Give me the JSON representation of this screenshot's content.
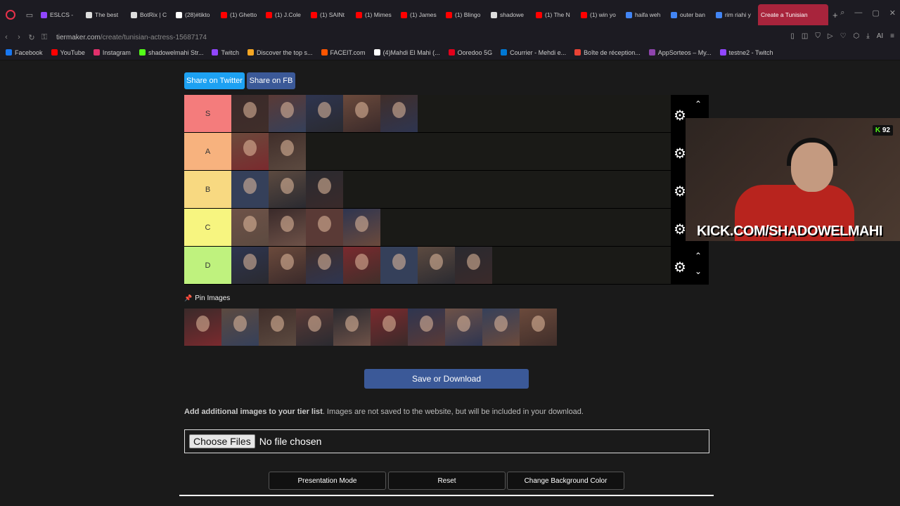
{
  "browser": {
    "tabs": [
      {
        "label": "ESLCS -",
        "color": "#9146ff"
      },
      {
        "label": "The best",
        "color": "#dddddd"
      },
      {
        "label": "BotRix | C",
        "color": "#dddddd"
      },
      {
        "label": "(28)#tikto",
        "color": "#ffffff"
      },
      {
        "label": "(1) Ghetto",
        "color": "#ff0000"
      },
      {
        "label": "(1) J.Cole",
        "color": "#ff0000"
      },
      {
        "label": "(1) SAINt",
        "color": "#ff0000"
      },
      {
        "label": "(1) Mimes",
        "color": "#ff0000"
      },
      {
        "label": "(1) James",
        "color": "#ff0000"
      },
      {
        "label": "(1) Blingo",
        "color": "#ff0000"
      },
      {
        "label": "shadowe",
        "color": "#dddddd"
      },
      {
        "label": "(1) The N",
        "color": "#ff0000"
      },
      {
        "label": "(1) win yo",
        "color": "#ff0000"
      },
      {
        "label": "haifa weh",
        "color": "#4285f4"
      },
      {
        "label": "outer ban",
        "color": "#4285f4"
      },
      {
        "label": "rim riahi y",
        "color": "#4285f4"
      }
    ],
    "active_tab": "Create a Tunisian",
    "url_host": "tiermaker.com",
    "url_path": "/create/tunisian-actress-15687174",
    "bookmarks": [
      {
        "label": "Facebook",
        "color": "#1877f2"
      },
      {
        "label": "YouTube",
        "color": "#ff0000"
      },
      {
        "label": "Instagram",
        "color": "#e1306c"
      },
      {
        "label": "shadowelmahi Str...",
        "color": "#53fc18"
      },
      {
        "label": "Twitch",
        "color": "#9146ff"
      },
      {
        "label": "Discover the top s...",
        "color": "#f5a623"
      },
      {
        "label": "FACEIT.com",
        "color": "#ff5500"
      },
      {
        "label": "(4)Mahdi El Mahi (...",
        "color": "#ffffff"
      },
      {
        "label": "Ooredoo 5G",
        "color": "#e3001b"
      },
      {
        "label": "Courrier - Mehdi e...",
        "color": "#0078d4"
      },
      {
        "label": "Boîte de réception...",
        "color": "#ea4335"
      },
      {
        "label": "AppSorteos – My...",
        "color": "#8e44ad"
      },
      {
        "label": "testne2 - Twitch",
        "color": "#9146ff"
      }
    ]
  },
  "share": {
    "twitter": "Share on Twitter",
    "facebook": "Share on FB"
  },
  "tiers": [
    {
      "label": "S",
      "color": "#f47c7c",
      "count": 5
    },
    {
      "label": "A",
      "color": "#f7b27e",
      "count": 2
    },
    {
      "label": "B",
      "color": "#f8d981",
      "count": 3
    },
    {
      "label": "C",
      "color": "#f7f580",
      "count": 4
    },
    {
      "label": "D",
      "color": "#bff27e",
      "count": 7
    }
  ],
  "pin_label": "Pin Images",
  "pool_count": 10,
  "save_button": "Save or Download",
  "add_images_bold": "Add additional images to your tier list",
  "add_images_rest": ". Images are not saved to the website, but will be included in your download.",
  "file_input": {
    "button": "Choose Files",
    "status": "No file chosen"
  },
  "bottom_buttons": {
    "presentation": "Presentation Mode",
    "reset": "Reset",
    "background": "Change Background Color"
  },
  "stream": {
    "kick_url": "KICK.COM/SHADOWELMAHI",
    "viewers": "92"
  }
}
